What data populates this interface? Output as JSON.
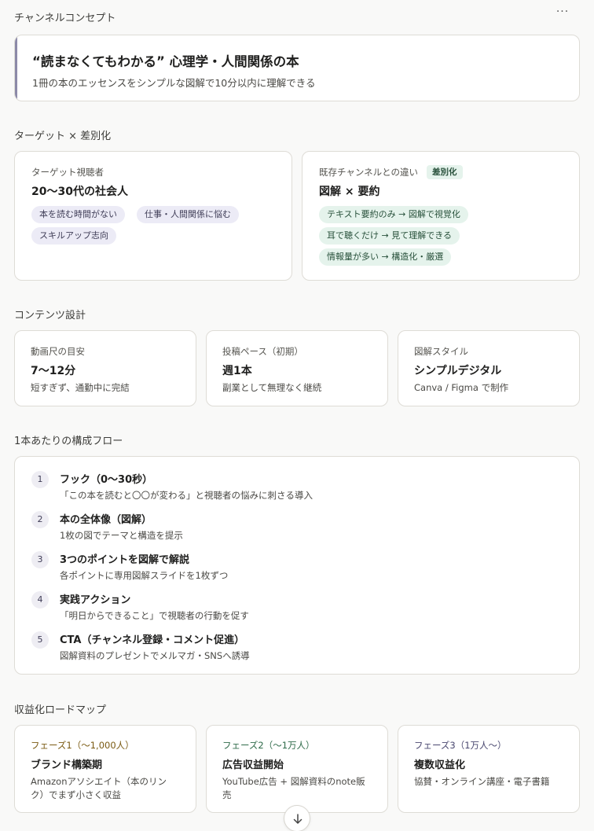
{
  "header": {
    "title": "チャンネルコンセプト",
    "more_label": "···"
  },
  "concept": {
    "title": "“読まなくてもわかる” 心理学・人間関係の本",
    "subtitle": "1冊の本のエッセンスをシンプルな図解で10分以内に理解できる"
  },
  "target_section": {
    "title": "ターゲット × 差別化",
    "audience": {
      "label": "ターゲット視聴者",
      "value": "20〜30代の社会人",
      "tags": [
        "本を読む時間がない",
        "仕事・人間関係に悩む",
        "スキルアップ志向"
      ]
    },
    "diff": {
      "label": "既存チャンネルとの違い",
      "badge": "差別化",
      "value": "図解 × 要約",
      "tags": [
        "テキスト要約のみ → 図解で視覚化",
        "耳で聴くだけ → 見て理解できる",
        "情報量が多い → 構造化・厳選"
      ]
    }
  },
  "content_section": {
    "title": "コンテンツ設計",
    "cards": [
      {
        "label": "動画尺の目安",
        "value": "7〜12分",
        "desc": "短すぎず、通勤中に完結"
      },
      {
        "label": "投稿ペース（初期）",
        "value": "週1本",
        "desc": "副業として無理なく継続"
      },
      {
        "label": "図解スタイル",
        "value": "シンプルデジタル",
        "desc": "Canva / Figma で制作"
      }
    ]
  },
  "flow_section": {
    "title": "1本あたりの構成フロー",
    "steps": [
      {
        "num": "1",
        "title": "フック（0〜30秒）",
        "desc": "「この本を読むと〇〇が変わる」と視聴者の悩みに刺さる導入"
      },
      {
        "num": "2",
        "title": "本の全体像（図解）",
        "desc": "1枚の図でテーマと構造を提示"
      },
      {
        "num": "3",
        "title": "3つのポイントを図解で解説",
        "desc": "各ポイントに専用図解スライドを1枚ずつ"
      },
      {
        "num": "4",
        "title": "実践アクション",
        "desc": "「明日からできること」で視聴者の行動を促す"
      },
      {
        "num": "5",
        "title": "CTA（チャンネル登録・コメント促進）",
        "desc": "図解資料のプレゼントでメルマガ・SNSへ誘導"
      }
    ]
  },
  "roadmap_section": {
    "title": "収益化ロードマップ",
    "phases": [
      {
        "label": "フェーズ1（〜1,000人）",
        "title": "ブランド構築期",
        "desc_lines": [
          "Amazonアソシエイト（本のリン",
          "ク）でまず小さく収益"
        ],
        "color": "#7a5a12"
      },
      {
        "label": "フェーズ2（〜1万人）",
        "title": "広告収益開始",
        "desc_lines": [
          "YouTube広告 + 図解資料のnote販",
          "売"
        ],
        "color": "#2f6b4a"
      },
      {
        "label": "フェーズ3（1万人〜）",
        "title": "複数収益化",
        "desc_lines": [
          "協賛・オンライン講座・電子書籍"
        ],
        "color": "#4a4870"
      }
    ]
  },
  "icons": {
    "scroll": "arrow-down-icon",
    "more": "more-horizontal-icon"
  }
}
